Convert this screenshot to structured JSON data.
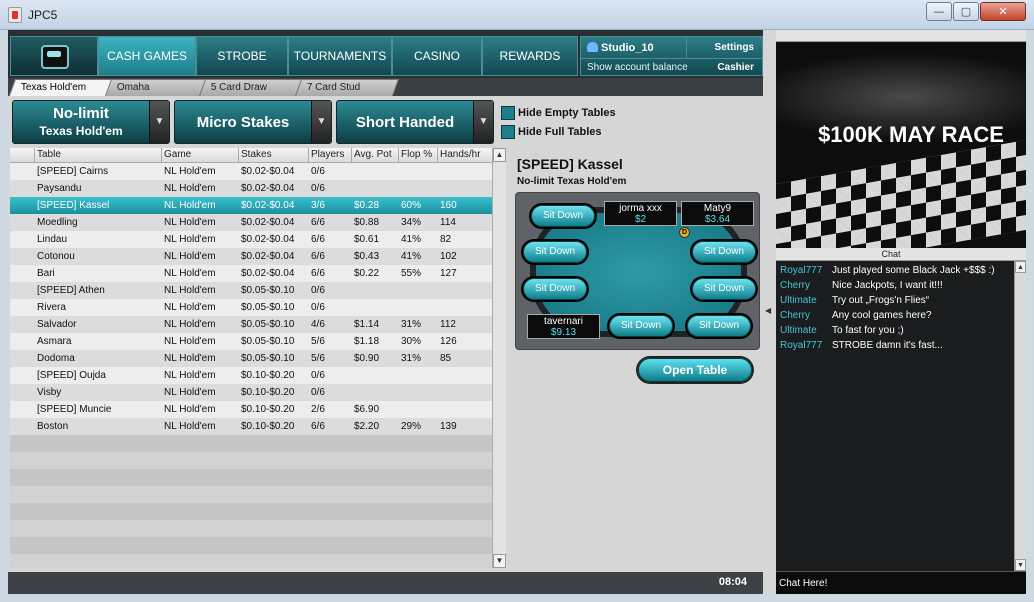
{
  "window": {
    "title": "JPC5",
    "min": "—",
    "max": "▢",
    "close": "✕"
  },
  "nav": {
    "tabs": [
      "CASH GAMES",
      "STROBE",
      "TOURNAMENTS",
      "CASINO",
      "REWARDS"
    ],
    "active_tab": "CASH GAMES",
    "username": "Studio_10",
    "settings": "Settings",
    "balance_link": "Show account balance",
    "cashier": "Cashier"
  },
  "subtabs": [
    "Texas Hold'em",
    "Omaha",
    "5 Card Draw",
    "7 Card Stud"
  ],
  "filters": {
    "limit_line1": "No-limit",
    "limit_line2": "Texas Hold'em",
    "stakes": "Micro Stakes",
    "table_size": "Short Handed",
    "arrow": "▼",
    "hide_empty": "Hide Empty Tables",
    "hide_full": "Hide Full Tables"
  },
  "list": {
    "columns": [
      "Table",
      "Game",
      "Stakes",
      "Players",
      "Avg. Pot",
      "Flop %",
      "Hands/hr"
    ],
    "rows": [
      [
        "[SPEED] Cairns",
        "NL Hold'em",
        "$0.02-$0.04",
        "0/6",
        "",
        "",
        ""
      ],
      [
        "Paysandu",
        "NL Hold'em",
        "$0.02-$0.04",
        "0/6",
        "",
        "",
        ""
      ],
      [
        "[SPEED] Kassel",
        "NL Hold'em",
        "$0.02-$0.04",
        "3/6",
        "$0.28",
        "60%",
        "160"
      ],
      [
        "Moedling",
        "NL Hold'em",
        "$0.02-$0.04",
        "6/6",
        "$0.88",
        "34%",
        "114"
      ],
      [
        "Lindau",
        "NL Hold'em",
        "$0.02-$0.04",
        "6/6",
        "$0.61",
        "41%",
        "82"
      ],
      [
        "Cotonou",
        "NL Hold'em",
        "$0.02-$0.04",
        "6/6",
        "$0.43",
        "41%",
        "102"
      ],
      [
        "Bari",
        "NL Hold'em",
        "$0.02-$0.04",
        "6/6",
        "$0.22",
        "55%",
        "127"
      ],
      [
        "[SPEED] Athen",
        "NL Hold'em",
        "$0.05-$0.10",
        "0/6",
        "",
        "",
        ""
      ],
      [
        "Rivera",
        "NL Hold'em",
        "$0.05-$0.10",
        "0/6",
        "",
        "",
        ""
      ],
      [
        "Salvador",
        "NL Hold'em",
        "$0.05-$0.10",
        "4/6",
        "$1.14",
        "31%",
        "112"
      ],
      [
        "Asmara",
        "NL Hold'em",
        "$0.05-$0.10",
        "5/6",
        "$1.18",
        "30%",
        "126"
      ],
      [
        "Dodoma",
        "NL Hold'em",
        "$0.05-$0.10",
        "5/6",
        "$0.90",
        "31%",
        "85"
      ],
      [
        "[SPEED] Oujda",
        "NL Hold'em",
        "$0.10-$0.20",
        "0/6",
        "",
        "",
        ""
      ],
      [
        "Visby",
        "NL Hold'em",
        "$0.10-$0.20",
        "0/6",
        "",
        "",
        ""
      ],
      [
        "[SPEED] Muncie",
        "NL Hold'em",
        "$0.10-$0.20",
        "2/6",
        "$6.90",
        "",
        ""
      ],
      [
        "Boston",
        "NL Hold'em",
        "$0.10-$0.20",
        "6/6",
        "$2.20",
        "29%",
        "139"
      ]
    ],
    "selected_row": 2,
    "empty_rows": 8,
    "scroll_up": "▲",
    "scroll_down": "▼"
  },
  "preview": {
    "title": "[SPEED] Kassel",
    "subtitle": "No-limit Texas Hold'em",
    "sit_down": "Sit Down",
    "players": [
      {
        "name": "jorma xxx",
        "stack": "$2"
      },
      {
        "name": "Maty9",
        "stack": "$3.64"
      },
      {
        "name": "tavernari",
        "stack": "$9.13"
      }
    ],
    "dealer": "D",
    "open_button": "Open Table"
  },
  "footer": {
    "clock": "08:04"
  },
  "sidebar": {
    "collapse_arrow": "◀",
    "banner": "$100K MAY RACE",
    "chat_title": "Chat",
    "chat": [
      {
        "who": "Royal777",
        "text": "Just played some Black Jack +$$$ :)"
      },
      {
        "who": "Cherry",
        "text": "Nice Jackpots, I want it!!!"
      },
      {
        "who": "Ultimate",
        "text": "Try out „Frogs'n Flies“"
      },
      {
        "who": "Cherry",
        "text": "Any cool games here?"
      },
      {
        "who": "Ultimate",
        "text": "To fast for you ;)"
      },
      {
        "who": "Royal777",
        "text": "STROBE damn it's fast..."
      }
    ],
    "chat_placeholder": "Chat Here!"
  },
  "colors": {
    "accent": "#1f9aa8",
    "selected_row": "#2aaebd",
    "chat_name": "#45c6d6"
  }
}
